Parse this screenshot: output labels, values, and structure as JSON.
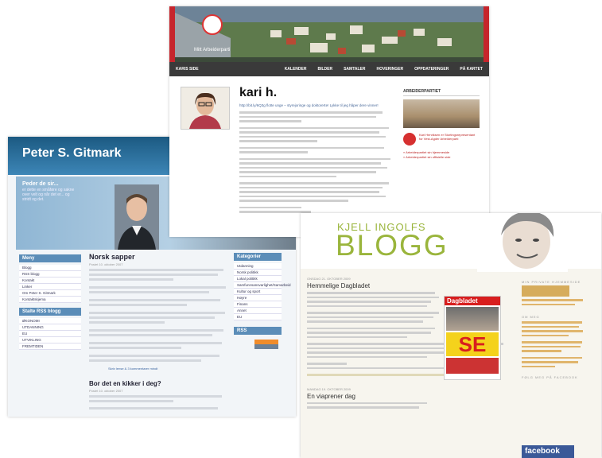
{
  "peter": {
    "title": "Peter S. Gitmark",
    "banner_title": "Peder de sir...",
    "banner_text": "er dette en småføre og sakne over velt og når det er... og stridt og det.",
    "nav_head": "Meny",
    "nav_items": [
      "Blogg",
      "RSS blogg",
      "Kontakt",
      "Linker",
      "Om Peter S. Gitmark",
      "Kontaktskjema"
    ],
    "archive_head": "Stalte RSS blogg",
    "archive_items": [
      "ØKONOMI",
      "UTDANNING",
      "EU",
      "UTVIKLING",
      "FREMTIDEN"
    ],
    "post1_title": "Norsk sapper",
    "post1_meta": "Postet 10. oktober 2007",
    "post1_more": "Skriv lense & 3 kommentarer mindt",
    "post2_title": "Bor det en kikker i deg?",
    "post2_meta": "Postet 10. oktober 2007",
    "right_head": "Kategorier",
    "right_items": [
      "Utdanning",
      "Norsk politikk",
      "Lokal politikk",
      "Samfunnsansvarlighet/Samarbeid",
      "Kultur og sport",
      "Høyre",
      "Finans",
      "Annet",
      "EU"
    ],
    "rss_head": "RSS"
  },
  "kari": {
    "brand": "Mitt Arbeiderparti",
    "nav_left": "KARIS SIDE",
    "nav_items": [
      "KALENDER",
      "BILDER",
      "SAMTALER",
      "HOVERINGER",
      "OPPDATERINGER",
      "PÅ KARTET"
    ],
    "name": "kari h.",
    "status": "http://bit.ly/6Q3g flotte unge – styrejoringe og doktorerte! Lykke til jeg håper dere vinner!",
    "side_head": "ARBEIDERPARTIET",
    "side_logo_text": "Kari Henriksen er Stortingsrepresentant for Vest-Agder Arbeiderparti",
    "side_link1": "» Arbeiderpartiet sin hjemmeside",
    "side_link2": "» Arbeiderpartiet sin offisielle side"
  },
  "kjell": {
    "small": "KJELL INGOLFS",
    "big": "BLOGG",
    "post1_date": "ONSDAG 21. OKTOBER 2009",
    "post1_title": "Hemmelige Dagbladet",
    "paper_label": "Dagbladet",
    "paper_headline": "SE",
    "post2_date": "MANDAG 19. OKTOBER 2009",
    "post2_title": "En viaprener dag",
    "side_t1": "MIN PRIVATE HJEMMESIDE",
    "side_t2": "OM MEG",
    "side_t3": "FØLG MEG PÅ FACEBOOK",
    "fb": "facebook"
  }
}
